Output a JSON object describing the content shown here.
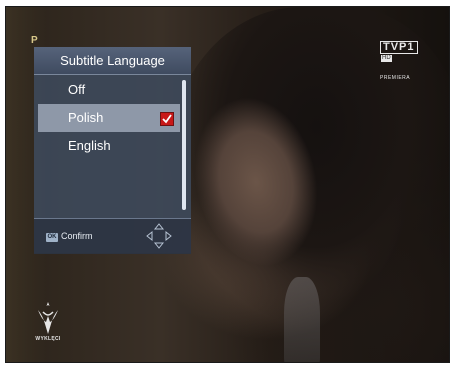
{
  "channel": {
    "logo_text": "TVP",
    "logo_number": "1",
    "hd_badge": "HD",
    "subtitle": "PREMIERA"
  },
  "corner_icon": "P",
  "program_logo": {
    "text": "WYKLĘCI",
    "icon": "eagle-emblem-icon"
  },
  "menu": {
    "title": "Subtitle Language",
    "items": [
      {
        "label": "Off",
        "selected": false,
        "checked": false
      },
      {
        "label": "Polish",
        "selected": true,
        "checked": true
      },
      {
        "label": "English",
        "selected": false,
        "checked": false
      }
    ],
    "footer": {
      "ok_key": "OK",
      "confirm_label": "Confirm",
      "nav_icon": "dpad-arrows-icon"
    }
  },
  "colors": {
    "panel": "#3e4a5c",
    "highlight": "#8e98a8",
    "checkbox": "#c81818"
  }
}
